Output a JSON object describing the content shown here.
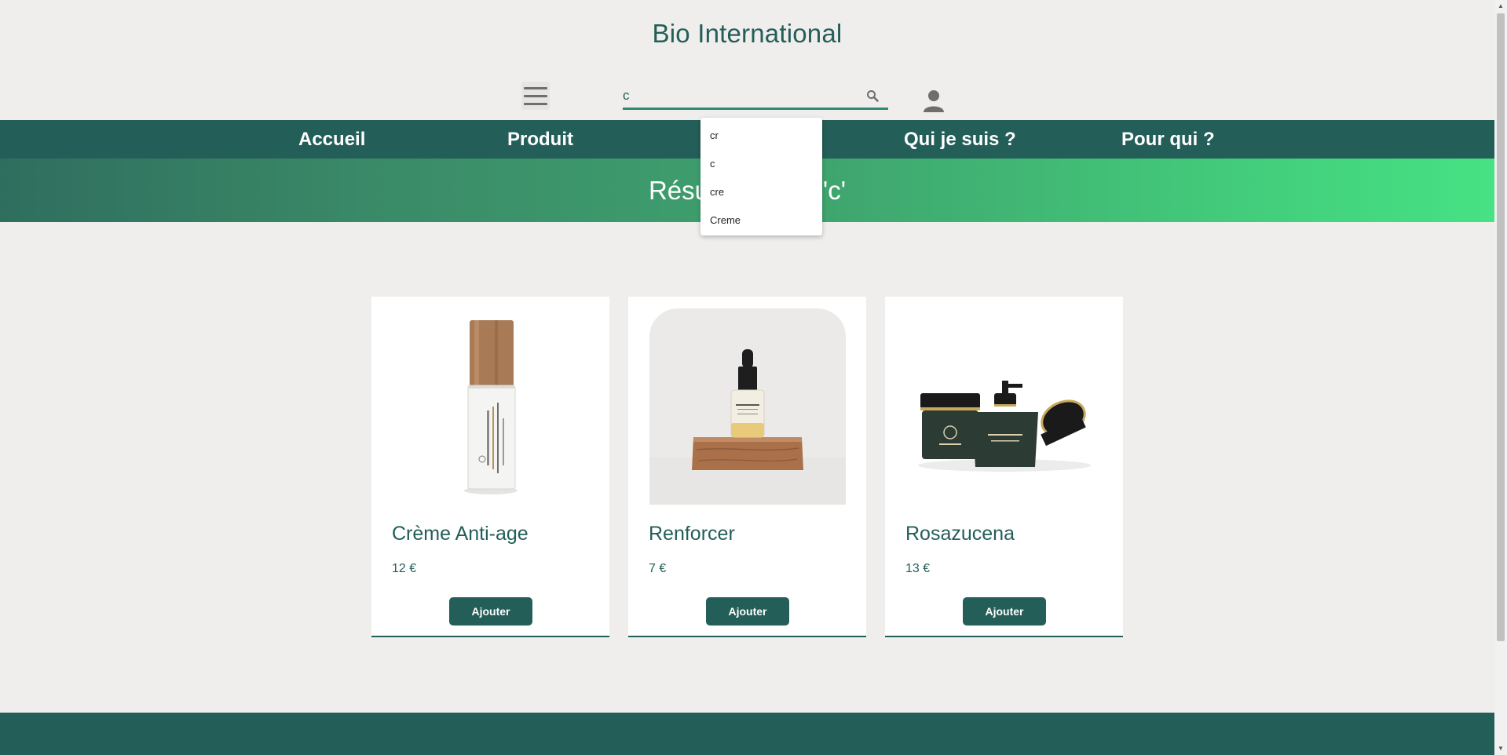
{
  "header": {
    "title": "Bio International",
    "search_value": "c",
    "menu_icon": "hamburger-menu-icon",
    "search_icon": "search-icon",
    "user_icon": "user-icon"
  },
  "nav": {
    "items": [
      {
        "label": "Accueil"
      },
      {
        "label": "Produit"
      },
      {
        "label": ""
      },
      {
        "label": "Qui je suis ?"
      },
      {
        "label": "Pour qui ?"
      }
    ]
  },
  "banner": {
    "text": "Résultats pour 'c'"
  },
  "autocomplete": {
    "suggestions": [
      "cr",
      "c",
      "cre",
      "Creme"
    ]
  },
  "products": [
    {
      "name": "Crème Anti-age",
      "price": "12 €",
      "button": "Ajouter"
    },
    {
      "name": "Renforcer",
      "price": "7 €",
      "button": "Ajouter"
    },
    {
      "name": "Rosazucena",
      "price": "13 €",
      "button": "Ajouter"
    }
  ],
  "colors": {
    "primary": "#245e58",
    "background": "#efeeec",
    "banner_start": "#2f6e5e",
    "banner_end": "#46e283"
  }
}
